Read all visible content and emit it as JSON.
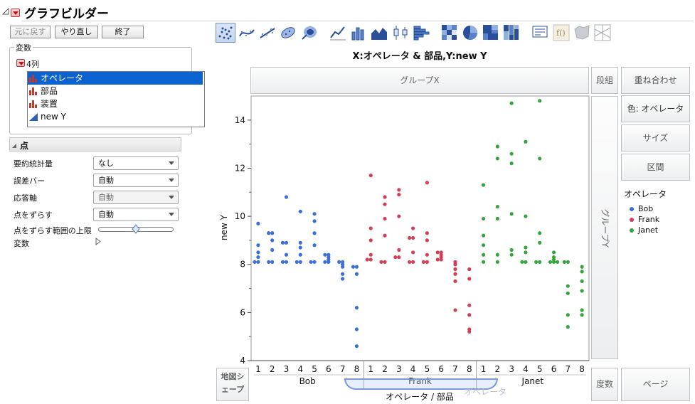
{
  "window": {
    "title": "グラフビルダー"
  },
  "toolbar": {
    "undo_label": "元に戻す",
    "redo_label": "やり直し",
    "done_label": "終了"
  },
  "variables_panel": {
    "title": "変数",
    "column_count_label": "4列",
    "columns": [
      {
        "label": "オペレータ",
        "icon": "nominal-bar-icon",
        "selected": true
      },
      {
        "label": "部品",
        "icon": "nominal-bar-icon",
        "selected": false
      },
      {
        "label": "装置",
        "icon": "nominal-bar-icon",
        "selected": false
      },
      {
        "label": "new Y",
        "icon": "continuous-triangle-icon",
        "selected": false
      }
    ]
  },
  "points_panel": {
    "title": "点",
    "properties": [
      {
        "label": "要約統計量",
        "value": "なし",
        "disabled": false
      },
      {
        "label": "誤差バー",
        "value": "自動",
        "disabled": false
      },
      {
        "label": "応答軸",
        "value": "自動",
        "disabled": true
      },
      {
        "label": "点をずらす",
        "value": "自動",
        "disabled": false
      }
    ],
    "jitter_limit_label": "点をずらす範囲の上限",
    "jitter_limit_fraction": 0.5,
    "variables_label": "変数"
  },
  "element_icons": [
    "points-icon",
    "smoother-icon",
    "line-of-fit-icon",
    "ellipse-icon",
    "contour-icon",
    "line-icon",
    "bar-icon",
    "area-icon",
    "box-plot-icon",
    "histogram-icon",
    "heatmap-icon",
    "pie-icon",
    "treemap-icon",
    "mosaic-icon",
    "caption-box-icon",
    "formula-icon",
    "map-shapes-icon",
    "parallel-icon"
  ],
  "graph": {
    "title": "X:オペレータ & 部品,Y:new Y",
    "group_x_label": "グループX",
    "group_y_label": "グループY",
    "wrap_label": "段組",
    "overlay_label": "重ね合わせ",
    "color_label": "色: オペレータ",
    "size_label": "サイズ",
    "interval_label": "区間",
    "map_shape_label": "地図シェープ",
    "freq_label": "度数",
    "page_label": "ページ",
    "drag_ghost_label": "オペレータ",
    "x_axis_label": "オペレータ / 部品",
    "y_axis_label": "new Y"
  },
  "legend": {
    "title": "オペレータ",
    "items": [
      {
        "label": "Bob",
        "color": "#3d6fd6"
      },
      {
        "label": "Frank",
        "color": "#d33f56"
      },
      {
        "label": "Janet",
        "color": "#34a63d"
      }
    ]
  },
  "chart_data": {
    "type": "scatter",
    "title": "X:オペレータ & 部品,Y:new Y",
    "xlabel": "オペレータ / 部品",
    "ylabel": "new Y",
    "ylim": [
      4,
      15
    ],
    "yticks": [
      4,
      6,
      8,
      10,
      12,
      14
    ],
    "groups": [
      "Bob",
      "Frank",
      "Janet"
    ],
    "parts": [
      "1",
      "2",
      "3",
      "4",
      "5",
      "6",
      "7",
      "8"
    ],
    "series": [
      {
        "name": "Bob",
        "color": "#3d6fd6",
        "points": [
          [
            8.1,
            8.1,
            8.3,
            8.5,
            8.8,
            9.7
          ],
          [
            8.1,
            8.1,
            8.6,
            9.0,
            9.3,
            9.3
          ],
          [
            8.1,
            8.1,
            8.4,
            8.9,
            8.9,
            10.8
          ],
          [
            8.1,
            8.1,
            8.4,
            8.7,
            8.9,
            10.2
          ],
          [
            8.1,
            8.1,
            8.8,
            9.3,
            9.8,
            10.1
          ],
          [
            8.1,
            8.1,
            8.2,
            8.3,
            8.4,
            8.4
          ],
          [
            7.4,
            7.6,
            7.9,
            8.0,
            8.1,
            8.1
          ],
          [
            4.6,
            5.3,
            6.2,
            7.6,
            7.9,
            7.9
          ]
        ]
      },
      {
        "name": "Frank",
        "color": "#d33f56",
        "points": [
          [
            8.2,
            8.2,
            8.4,
            9.0,
            9.5,
            11.7
          ],
          [
            8.1,
            8.1,
            9.2,
            9.9,
            10.5,
            10.8
          ],
          [
            8.3,
            8.3,
            8.6,
            10.0,
            10.9,
            11.1
          ],
          [
            8.1,
            8.1,
            8.5,
            9.1,
            9.1,
            9.5
          ],
          [
            8.1,
            8.1,
            8.4,
            9.0,
            9.3,
            11.4
          ],
          [
            8.2,
            8.2,
            8.3,
            8.4,
            8.5,
            8.5
          ],
          [
            6.1,
            7.3,
            7.6,
            7.8,
            8.0,
            8.1
          ],
          [
            5.2,
            5.3,
            5.9,
            6.3,
            7.4,
            7.8
          ]
        ]
      },
      {
        "name": "Janet",
        "color": "#34a63d",
        "points": [
          [
            8.1,
            8.4,
            8.8,
            9.2,
            9.9,
            11.3
          ],
          [
            8.1,
            8.4,
            9.9,
            10.4,
            12.4,
            12.9
          ],
          [
            8.4,
            8.6,
            10.1,
            12.2,
            12.6,
            14.7
          ],
          [
            8.1,
            8.1,
            8.5,
            8.7,
            10.0,
            13.1
          ],
          [
            8.1,
            8.1,
            8.9,
            9.3,
            12.4,
            14.8
          ],
          [
            8.1,
            8.1,
            8.1,
            8.2,
            8.3,
            8.5
          ],
          [
            5.4,
            5.9,
            6.8,
            7.1,
            8.1,
            8.1
          ],
          [
            5.9,
            6.1,
            6.9,
            7.3,
            7.7,
            7.9
          ]
        ]
      }
    ]
  }
}
